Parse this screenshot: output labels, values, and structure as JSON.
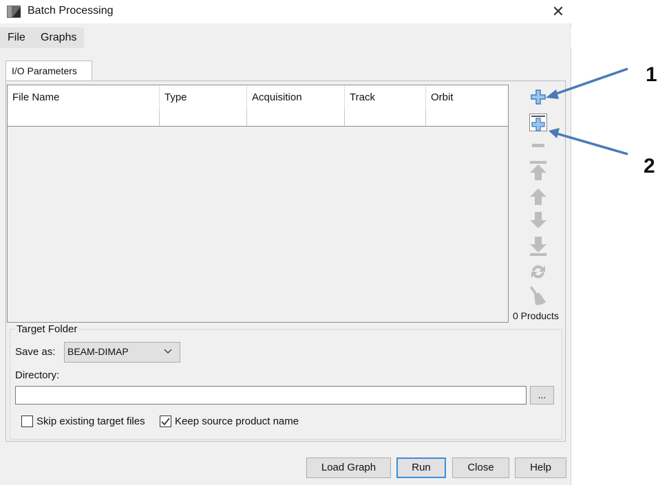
{
  "window": {
    "title": "Batch Processing",
    "close_label": "✕",
    "menu": [
      "File",
      "Graphs"
    ]
  },
  "tabs": [
    "I/O Parameters"
  ],
  "table": {
    "columns": [
      "File Name",
      "Type",
      "Acquisition",
      "Track",
      "Orbit"
    ],
    "rows": []
  },
  "side_toolbar": {
    "buttons": [
      "add-icon",
      "add-opened-icon",
      "remove-icon",
      "move-top-icon",
      "move-up-icon",
      "move-down-icon",
      "move-bottom-icon",
      "refresh-icon",
      "clear-icon"
    ],
    "products_count": "0 Products"
  },
  "target_folder": {
    "legend": "Target Folder",
    "save_as_label": "Save as:",
    "save_as_value": "BEAM-DIMAP",
    "directory_label": "Directory:",
    "directory_value": "",
    "browse_label": "...",
    "skip_existing_label": "Skip existing target files",
    "skip_existing_checked": false,
    "keep_source_label": "Keep source product name",
    "keep_source_checked": true
  },
  "buttons": {
    "load_graph": "Load Graph",
    "run": "Run",
    "close": "Close",
    "help": "Help"
  },
  "annotations": {
    "callout_1": "1",
    "callout_2": "2",
    "arrow_color": "#4a7ab5"
  },
  "colors": {
    "accent_blue": "#3c8ed8",
    "plus_fill": "#7fb3e0"
  }
}
